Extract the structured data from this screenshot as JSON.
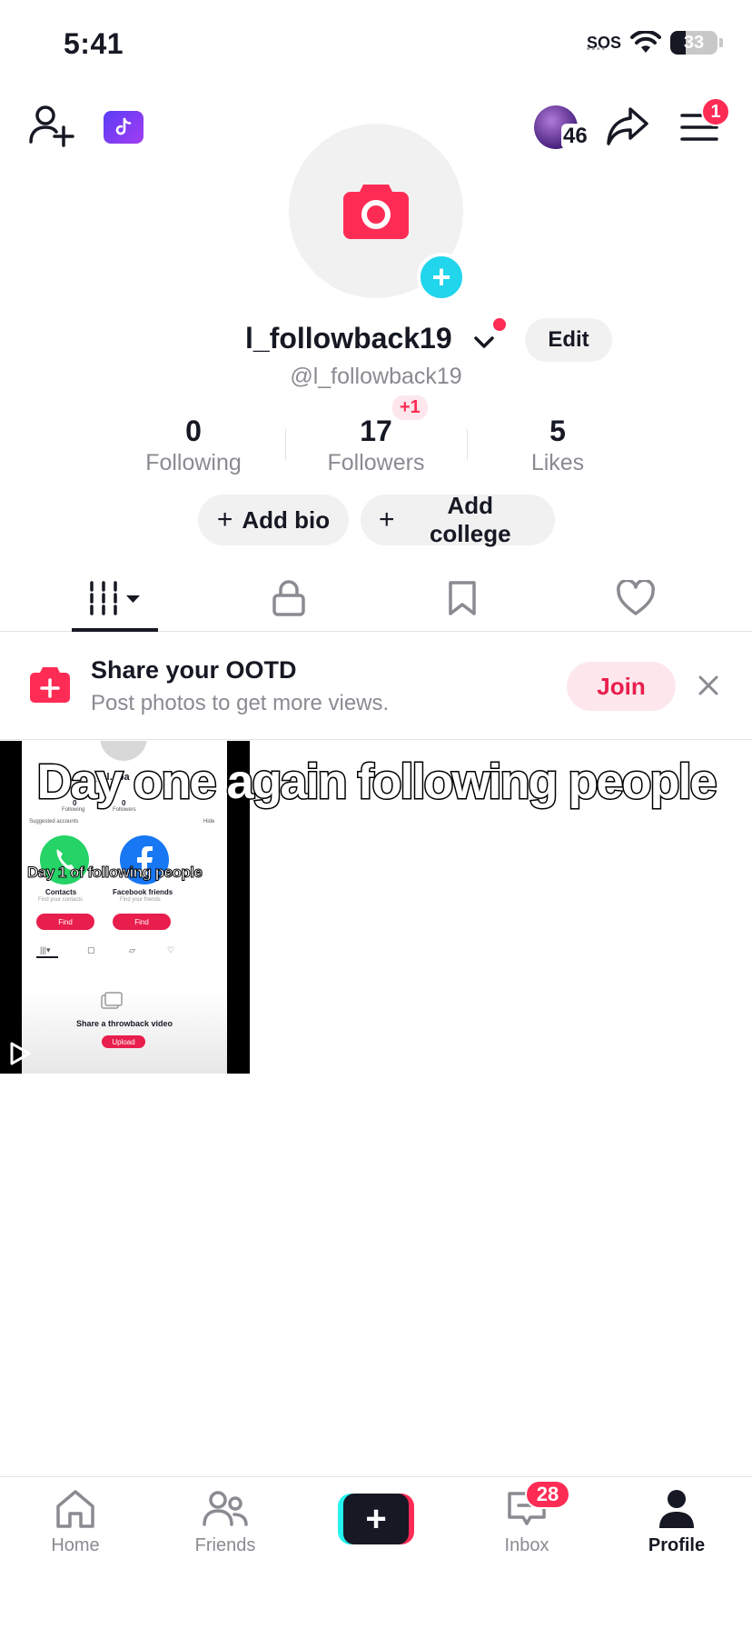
{
  "status_bar": {
    "time": "5:41",
    "sos": "SOS",
    "battery": "33",
    "battery_level": 0.33
  },
  "header": {
    "story_count": "46",
    "menu_badge": "1"
  },
  "profile": {
    "name": "l_followback19",
    "username": "@l_followback19",
    "edit_label": "Edit",
    "stats": [
      {
        "value": "0",
        "label": "Following"
      },
      {
        "value": "17",
        "label": "Followers"
      },
      {
        "value": "5",
        "label": "Likes"
      }
    ],
    "followers_delta": "+1",
    "add_bio_label": "Add bio",
    "add_college_label": "Add college"
  },
  "promo": {
    "title": "Share your OOTD",
    "subtitle": "Post photos to get more views.",
    "join_label": "Join"
  },
  "video": {
    "caption": "Day one again following people",
    "thumb": {
      "name": "l_fol...ba",
      "overlay": "Day 1 of following people",
      "following": "Following",
      "followers": "Followers",
      "suggested": "Suggested accounts",
      "hide": "Hide",
      "contacts": "Contacts",
      "contacts_sub": "Find your contacts",
      "facebook": "Facebook friends",
      "facebook_sub": "Find your friends",
      "find": "Find",
      "throwback": "Share a throwback video",
      "upload": "Upload",
      "zero": "0"
    }
  },
  "nav": {
    "items": [
      {
        "label": "Home"
      },
      {
        "label": "Friends"
      },
      {
        "label": "Inbox"
      },
      {
        "label": "Profile"
      }
    ],
    "inbox_badge": "28"
  },
  "colors": {
    "accent": "#fe2c55",
    "cyan": "#20d5ec",
    "muted": "#8a8b91",
    "pill": "#f1f1f2"
  }
}
